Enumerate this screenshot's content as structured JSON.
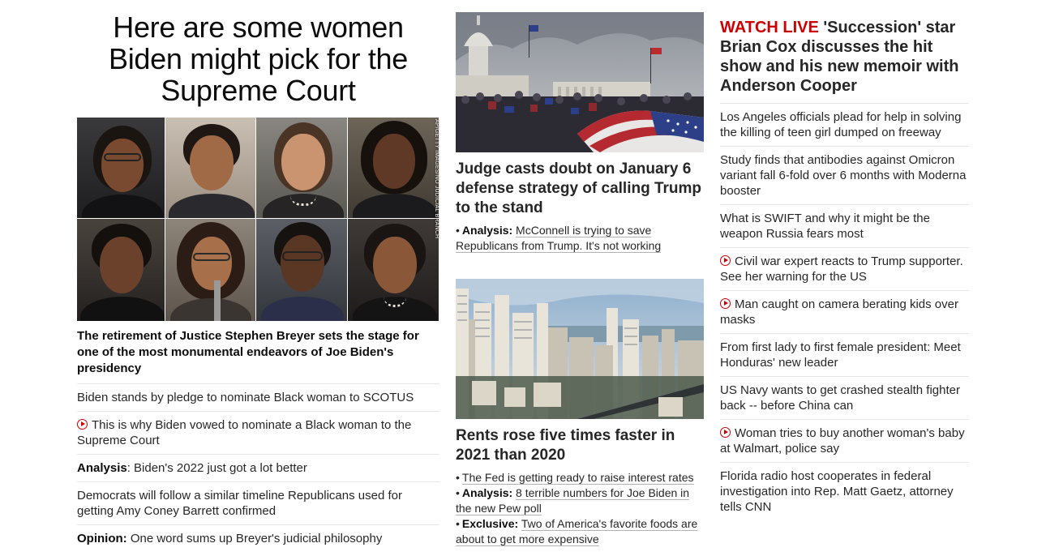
{
  "col1": {
    "headline": "Here are some women Biden might pick for the Supreme Court",
    "image_credit": "AP/GETTY IMAGES/NO JUDICIAL BRANCH",
    "subheadline": "The retirement of Justice Stephen Breyer sets the stage for one of the most monumental endeavors of Joe Biden's presidency",
    "items": [
      {
        "prefix": "",
        "text": "Biden stands by pledge to nominate Black woman to SCOTUS",
        "video": false
      },
      {
        "prefix": "",
        "text": "This is why Biden vowed to nominate a Black woman to the Supreme Court",
        "video": true
      },
      {
        "prefix": "Analysis",
        "text": ": Biden's 2022 just got a lot better",
        "video": false
      },
      {
        "prefix": "",
        "text": "Democrats will follow a similar timeline Republicans used for getting Amy Coney Barrett confirmed",
        "video": false
      },
      {
        "prefix": "Opinion:",
        "text": " One word sums up Breyer's judicial philosophy",
        "video": false
      }
    ]
  },
  "col2": {
    "story1": {
      "headline": "Judge casts doubt on January 6 defense strategy of calling Trump to the stand",
      "links": [
        {
          "prefix": "Analysis:",
          "text": "McConnell is trying to save Republicans from Trump. It's not working"
        }
      ]
    },
    "story2": {
      "headline": "Rents rose five times faster in 2021 than 2020",
      "links": [
        {
          "prefix": "",
          "text": "The Fed is getting ready to raise interest rates"
        },
        {
          "prefix": "Analysis:",
          "text": "8 terrible numbers for Joe Biden in the new Pew poll"
        },
        {
          "prefix": "Exclusive",
          "text": "Two of America's favorite foods are about to get more expensive"
        }
      ]
    }
  },
  "col3": {
    "live_label": "WATCH LIVE",
    "live_text": "'Succession' star Brian Cox discusses the hit show and his new memoir with Anderson Cooper",
    "items": [
      {
        "text": "Los Angeles officials plead for help in solving the killing of teen girl dumped on freeway",
        "video": false
      },
      {
        "text": "Study finds that antibodies against Omicron variant fall 6-fold over 6 months with Moderna booster",
        "video": false
      },
      {
        "text": "What is SWIFT and why it might be the weapon Russia fears most",
        "video": false
      },
      {
        "text": "Civil war expert reacts to Trump supporter. See her warning for the US",
        "video": true
      },
      {
        "text": "Man caught on camera berating kids over masks",
        "video": true
      },
      {
        "text": "From first lady to first female president: Meet Honduras' new leader",
        "video": false
      },
      {
        "text": "US Navy wants to get crashed stealth fighter back -- before China can",
        "video": false
      },
      {
        "text": "Woman tries to buy another woman's baby at Walmart, police say",
        "video": true
      },
      {
        "text": "Florida radio host cooperates in federal investigation into Rep. Matt Gaetz, attorney tells CNN",
        "video": false
      }
    ]
  },
  "colors": {
    "live_red": "#cc0000",
    "text": "#262626",
    "divider": "#e6e6e6"
  }
}
